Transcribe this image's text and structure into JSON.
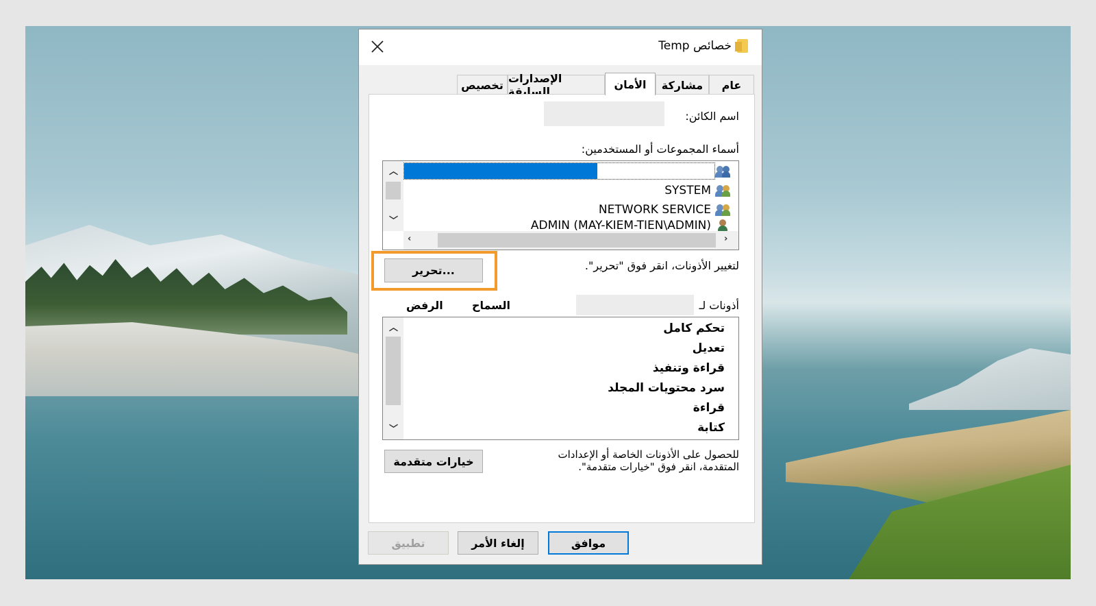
{
  "window": {
    "title": "خصائص Temp",
    "close_label": "×"
  },
  "tabs": [
    {
      "label": "تخصيص",
      "active": false
    },
    {
      "label": "الإصدارات السابقة",
      "active": false
    },
    {
      "label": "الأمان",
      "active": true
    },
    {
      "label": "مشاركة",
      "active": false
    },
    {
      "label": "عام",
      "active": false
    }
  ],
  "security": {
    "object_name_label": "اسم الكائن:",
    "groups_label": "أسماء المجموعات أو المستخدمين:",
    "users": [
      {
        "name": "",
        "selected": true,
        "icon": "group-users-icon"
      },
      {
        "name": "SYSTEM",
        "selected": false,
        "icon": "group-users-icon"
      },
      {
        "name": "NETWORK SERVICE",
        "selected": false,
        "icon": "group-users-icon"
      },
      {
        "name": "ADMIN (MAY-KIEM-TIEN\\ADMIN)",
        "selected": false,
        "icon": "single-user-icon"
      }
    ],
    "change_hint": "لتغيير الأذونات، انقر فوق \"تحرير\".",
    "edit_button": "تحرير...",
    "permissions_for_label": "أذونات لـ",
    "allow_header": "السماح",
    "deny_header": "الرفض",
    "permissions": [
      "تحكم كامل",
      "تعديل",
      "قراءة وتنفيذ",
      "سرد محتويات المجلد",
      "قراءة",
      "كتابة"
    ],
    "advanced_hint_line1": "للحصول على الأذونات الخاصة أو الإعدادات",
    "advanced_hint_line2": "المتقدمة، انقر فوق \"خيارات متقدمة\".",
    "advanced_button": "خيارات متقدمة"
  },
  "footer": {
    "ok": "موافق",
    "cancel": "إلغاء الأمر",
    "apply": "تطبيق"
  },
  "colors": {
    "selection": "#0078d7",
    "highlight_box": "#f39a2c"
  }
}
